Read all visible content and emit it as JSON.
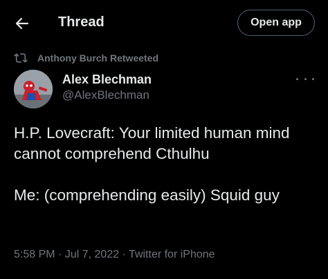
{
  "header": {
    "back_icon": "arrow-left-icon",
    "title": "Thread",
    "open_app_label": "Open app"
  },
  "retweet": {
    "icon": "retweet-icon",
    "text": "Anthony Burch Retweeted"
  },
  "author": {
    "name": "Alex Blechman",
    "handle": "@AlexBlechman",
    "avatar": "avatar-image"
  },
  "tweet": {
    "text": "H.P. Lovecraft: Your limited human mind cannot comprehend Cthulhu\n\nMe: (comprehending easily) Squid guy",
    "time": "5:58 PM",
    "date": "Jul 7, 2022",
    "source": "Twitter for iPhone"
  },
  "colors": {
    "background": "#000000",
    "primary_text": "#e7e9ea",
    "secondary_text": "#71767b",
    "border": "#536471"
  }
}
